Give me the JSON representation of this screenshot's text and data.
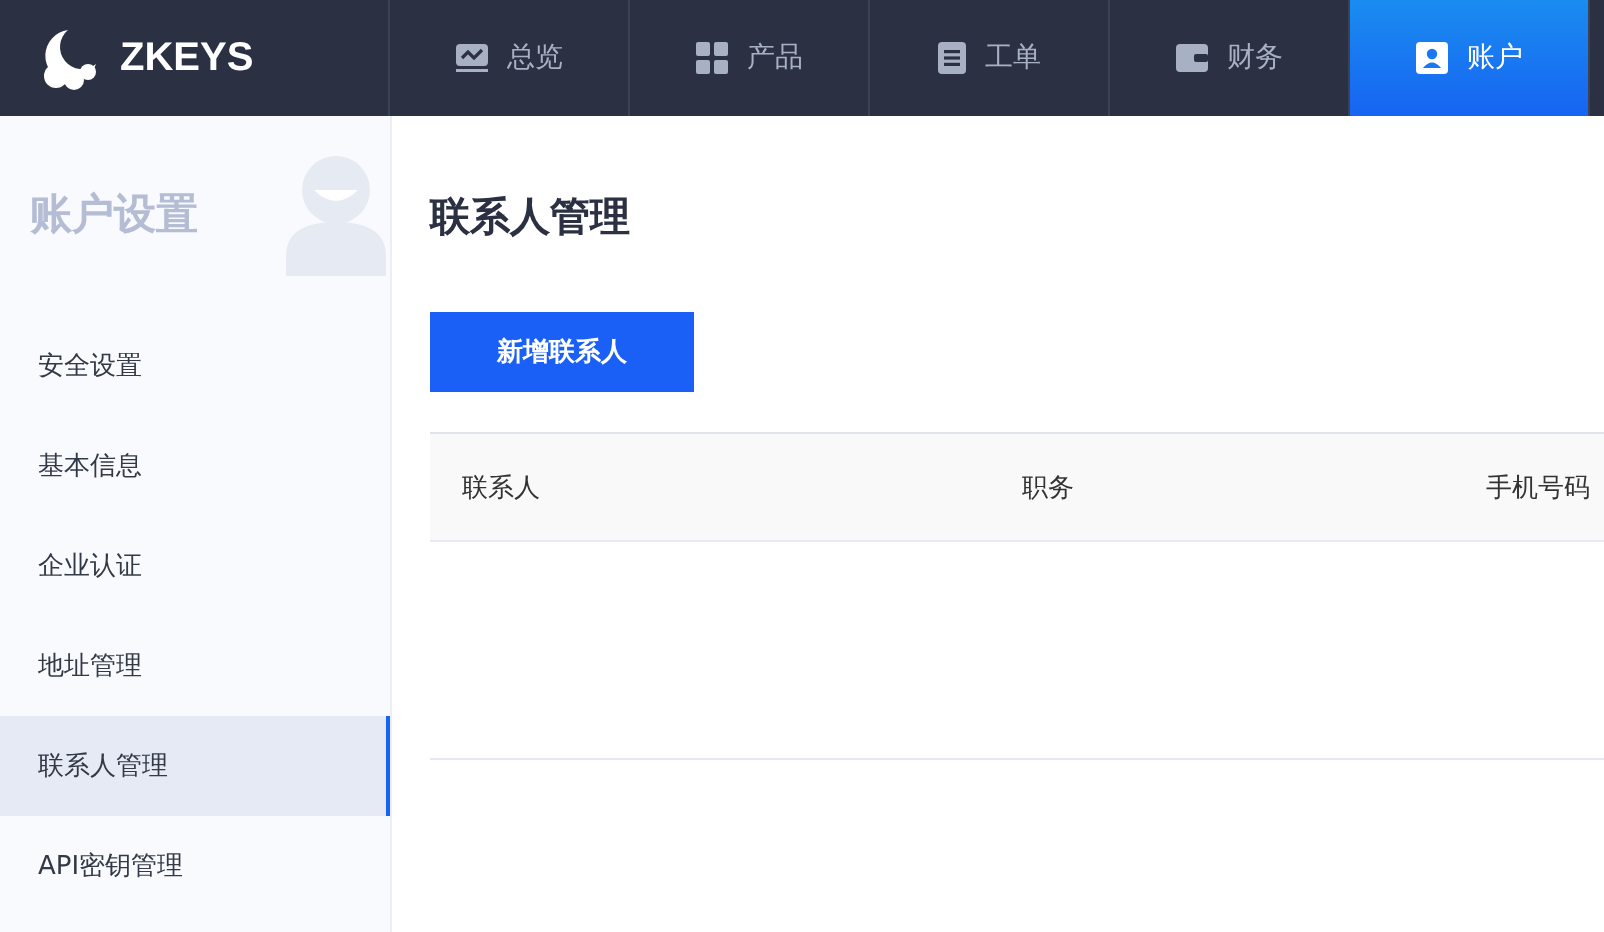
{
  "brand": {
    "name": "ZKEYS"
  },
  "nav": [
    {
      "label": "总览",
      "selected": false
    },
    {
      "label": "产品",
      "selected": false
    },
    {
      "label": "工单",
      "selected": false
    },
    {
      "label": "财务",
      "selected": false
    },
    {
      "label": "账户",
      "selected": true
    }
  ],
  "sidebar": {
    "title": "账户设置",
    "items": [
      {
        "label": "安全设置",
        "selected": false
      },
      {
        "label": "基本信息",
        "selected": false
      },
      {
        "label": "企业认证",
        "selected": false
      },
      {
        "label": "地址管理",
        "selected": false
      },
      {
        "label": "联系人管理",
        "selected": true
      },
      {
        "label": "API密钥管理",
        "selected": false
      }
    ]
  },
  "page": {
    "title": "联系人管理",
    "add_button": "新增联系人"
  },
  "table": {
    "columns": [
      "联系人",
      "职务",
      "手机号码"
    ]
  }
}
